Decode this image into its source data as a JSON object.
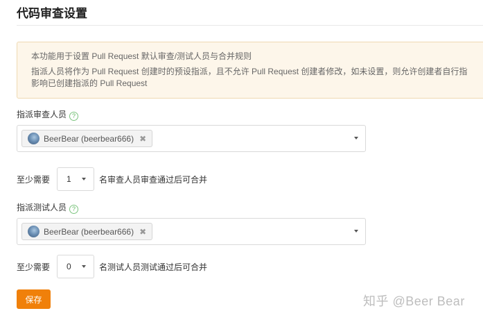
{
  "page": {
    "title": "代码审查设置"
  },
  "notice": {
    "line1": "本功能用于设置 Pull Request 默认审查/测试人员与合并规则",
    "line2": "指派人员将作为 Pull Request 创建时的预设指派，且不允许 Pull Request 创建者修改，如未设置，则允许创建者自行指",
    "line3": "影响已创建指派的 Pull Request"
  },
  "reviewers": {
    "label": "指派审查人员",
    "help_icon": "?",
    "selected": [
      {
        "name": "BeerBear (beerbear666)",
        "remove": "✖"
      }
    ],
    "min_prefix": "至少需要",
    "min_value": "1",
    "min_suffix": "名审查人员审查通过后可合并"
  },
  "testers": {
    "label": "指派测试人员",
    "help_icon": "?",
    "selected": [
      {
        "name": "BeerBear (beerbear666)",
        "remove": "✖"
      }
    ],
    "min_prefix": "至少需要",
    "min_value": "0",
    "min_suffix": "名测试人员测试通过后可合并"
  },
  "actions": {
    "save_label": "保存"
  },
  "watermark": {
    "text": "知乎 @Beer Bear"
  },
  "colors": {
    "accent": "#f0800a",
    "notice_bg": "#fdf6ea",
    "help_icon": "#5cb85c"
  },
  "icons": {
    "help": "help-icon",
    "remove": "close-icon",
    "dropdown": "caret-down-icon",
    "avatar": "avatar"
  }
}
